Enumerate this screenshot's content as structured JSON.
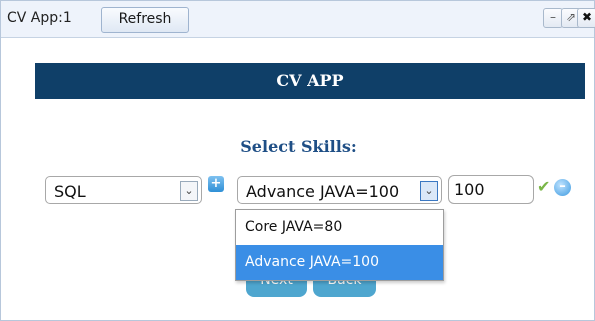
{
  "window": {
    "title": "CV App:1",
    "refresh_label": "Refresh",
    "controls": {
      "minimize": "–",
      "restore": "⇗",
      "close": "✖"
    }
  },
  "banner": {
    "title": "CV APP"
  },
  "form": {
    "heading": "Select Skills:",
    "category_select": {
      "value": "SQL"
    },
    "skill_select": {
      "value": "Advance JAVA=100"
    },
    "score_input": {
      "value": "100"
    }
  },
  "dropdown": {
    "options": [
      {
        "label": "Core JAVA=80",
        "selected": false
      },
      {
        "label": "Advance JAVA=100",
        "selected": true
      }
    ]
  },
  "buttons": {
    "next_label": "Next",
    "back_label": "Back"
  },
  "icons": {
    "add": "plus-icon",
    "confirm": "checkmark-icon",
    "remove": "minus-icon"
  },
  "colors": {
    "banner": "#0f3f68",
    "heading": "#1f4f86",
    "selected_option": "#3a8ee6",
    "buttons": "#4ea6cf"
  }
}
